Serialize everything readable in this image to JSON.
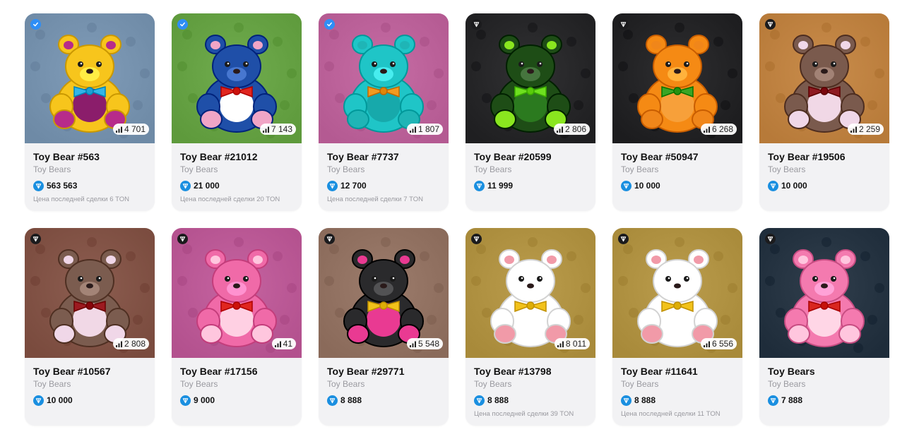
{
  "cards": [
    {
      "title": "Toy Bear #563",
      "collection": "Toy Bears",
      "price": "563 563",
      "last_sale": "Цена последней сделки 6 TON",
      "count": "4 701",
      "badge": "blue",
      "bg": "#6e8aa6",
      "bear": "#f7c51c",
      "belly": "#8b1d6b",
      "bow": "#32b5e8",
      "paws": "#b72b8a"
    },
    {
      "title": "Toy Bear #21012",
      "collection": "Toy Bears",
      "price": "21 000",
      "last_sale": "Цена последней сделки 20 TON",
      "count": "7 143",
      "badge": "blue",
      "bg": "#5e9a3c",
      "bear": "#1f4fa8",
      "belly": "#ffffff",
      "bow": "#e0261f",
      "paws": "#f1a5c6"
    },
    {
      "title": "Toy Bear #7737",
      "collection": "Toy Bears",
      "price": "12 700",
      "last_sale": "Цена последней сделки 7 TON",
      "count": "1 807",
      "badge": "blue",
      "bg": "#b45a92",
      "bear": "#1fc5c7",
      "belly": "#17a9ab",
      "bow": "#f39a1f",
      "paws": "#1fb5b6"
    },
    {
      "title": "Toy Bear #20599",
      "collection": "Toy Bears",
      "price": "11 999",
      "last_sale": "",
      "count": "2 806",
      "badge": "dark",
      "bg": "#1f1f21",
      "bear": "#1e4d16",
      "belly": "#2b7a1f",
      "bow": "#6ee01f",
      "paws": "#8ae61f"
    },
    {
      "title": "Toy Bear #50947",
      "collection": "Toy Bears",
      "price": "10 000",
      "last_sale": "",
      "count": "6 268",
      "badge": "dark",
      "bg": "#1c1c1e",
      "bear": "#f58a14",
      "belly": "#f7a03a",
      "bow": "#3aa525",
      "paws": "#f0861a"
    },
    {
      "title": "Toy Bear #19506",
      "collection": "Toy Bears",
      "price": "10 000",
      "last_sale": "",
      "count": "2 259",
      "badge": "dark",
      "bg": "#b77a39",
      "bear": "#7a5a4d",
      "belly": "#f1d8e6",
      "bow": "#8e1b22",
      "paws": "#f0d7e8"
    },
    {
      "title": "Toy Bear #10567",
      "collection": "Toy Bears",
      "price": "10 000",
      "last_sale": "",
      "count": "2 808",
      "badge": "dark",
      "bg": "#7a4b3e",
      "bear": "#7b5c4f",
      "belly": "#f1d8e6",
      "bow": "#9c1a20",
      "paws": "#f0d7e8"
    },
    {
      "title": "Toy Bear #17156",
      "collection": "Toy Bears",
      "price": "9 000",
      "last_sale": "",
      "count": "41",
      "badge": "dark",
      "bg": "#b3518e",
      "bear": "#f06aa8",
      "belly": "#ffd0e3",
      "bow": "#e0261f",
      "paws": "#ffc6de"
    },
    {
      "title": "Toy Bear #29771",
      "collection": "Toy Bears",
      "price": "8 888",
      "last_sale": "",
      "count": "5 548",
      "badge": "dark",
      "bg": "#8a6a5a",
      "bear": "#2a2a2c",
      "belly": "#e93a92",
      "bow": "#f2c21a",
      "paws": "#e93a92"
    },
    {
      "title": "Toy Bear #13798",
      "collection": "Toy Bears",
      "price": "8 888",
      "last_sale": "Цена последней сделки 39 TON",
      "count": "8 011",
      "badge": "dark",
      "bg": "#a88a3a",
      "bear": "#ffffff",
      "belly": "#ffffff",
      "bow": "#f2c21a",
      "paws": "#f19aa8"
    },
    {
      "title": "Toy Bear #11641",
      "collection": "Toy Bears",
      "price": "8 888",
      "last_sale": "Цена последней сделки 11 TON",
      "count": "6 556",
      "badge": "dark",
      "bg": "#a88a3a",
      "bear": "#ffffff",
      "belly": "#ffffff",
      "bow": "#f2c21a",
      "paws": "#f19aa8"
    },
    {
      "title": "Toy Bears",
      "collection": "Toy Bears",
      "price": "7 888",
      "last_sale": "",
      "count": "",
      "badge": "dark",
      "bg": "#1e2c3a",
      "bear": "#f47aaf",
      "belly": "#ffd6e6",
      "bow": "#d9261f",
      "paws": "#ffc6de"
    }
  ]
}
